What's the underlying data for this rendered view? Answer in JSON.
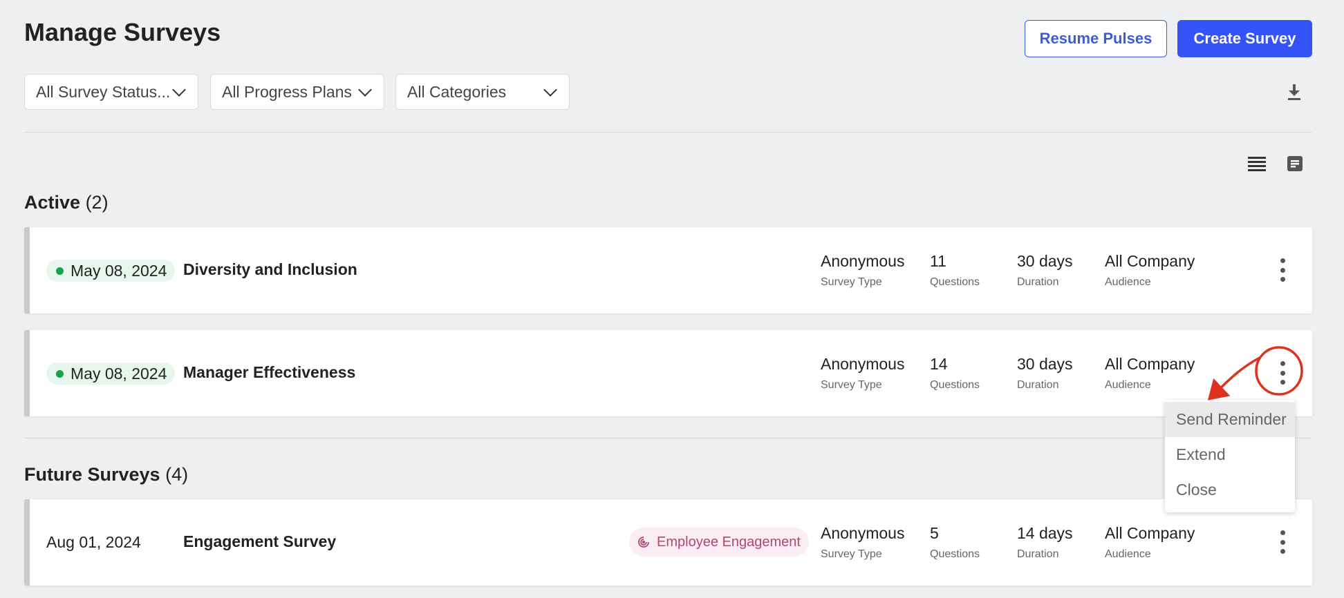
{
  "header": {
    "title": "Manage Surveys",
    "resume_label": "Resume Pulses",
    "create_label": "Create Survey"
  },
  "filters": {
    "status": "All Survey Status...",
    "progress": "All Progress Plans",
    "categories": "All Categories"
  },
  "icons": {
    "download": "download-icon",
    "list_view": "list-view-icon",
    "card_view": "card-view-icon",
    "more": "kebab-menu-icon",
    "tag": "engagement-icon"
  },
  "sections": {
    "active": {
      "title": "Active",
      "count": "(2)"
    },
    "future": {
      "title": "Future Surveys",
      "count": "(4)"
    }
  },
  "labels": {
    "survey_type": "Survey Type",
    "questions": "Questions",
    "duration": "Duration",
    "audience": "Audience"
  },
  "surveys": [
    {
      "date": "May 08, 2024",
      "name": "Diversity and Inclusion",
      "type": "Anonymous",
      "questions": "11",
      "duration": "30 days",
      "audience": "All Company"
    },
    {
      "date": "May 08, 2024",
      "name": "Manager Effectiveness",
      "type": "Anonymous",
      "questions": "14",
      "duration": "30 days",
      "audience": "All Company"
    },
    {
      "date": "Aug 01, 2024",
      "name": "Engagement Survey",
      "tag": "Employee Engagement",
      "type": "Anonymous",
      "questions": "5",
      "duration": "14 days",
      "audience": "All Company"
    }
  ],
  "menu": {
    "items": [
      "Send Reminder",
      "Extend",
      "Close"
    ]
  },
  "colors": {
    "primary": "#3653f5",
    "status_active": "#16a34a",
    "tag_text": "#b0457a",
    "annotation": "#e0301e"
  }
}
